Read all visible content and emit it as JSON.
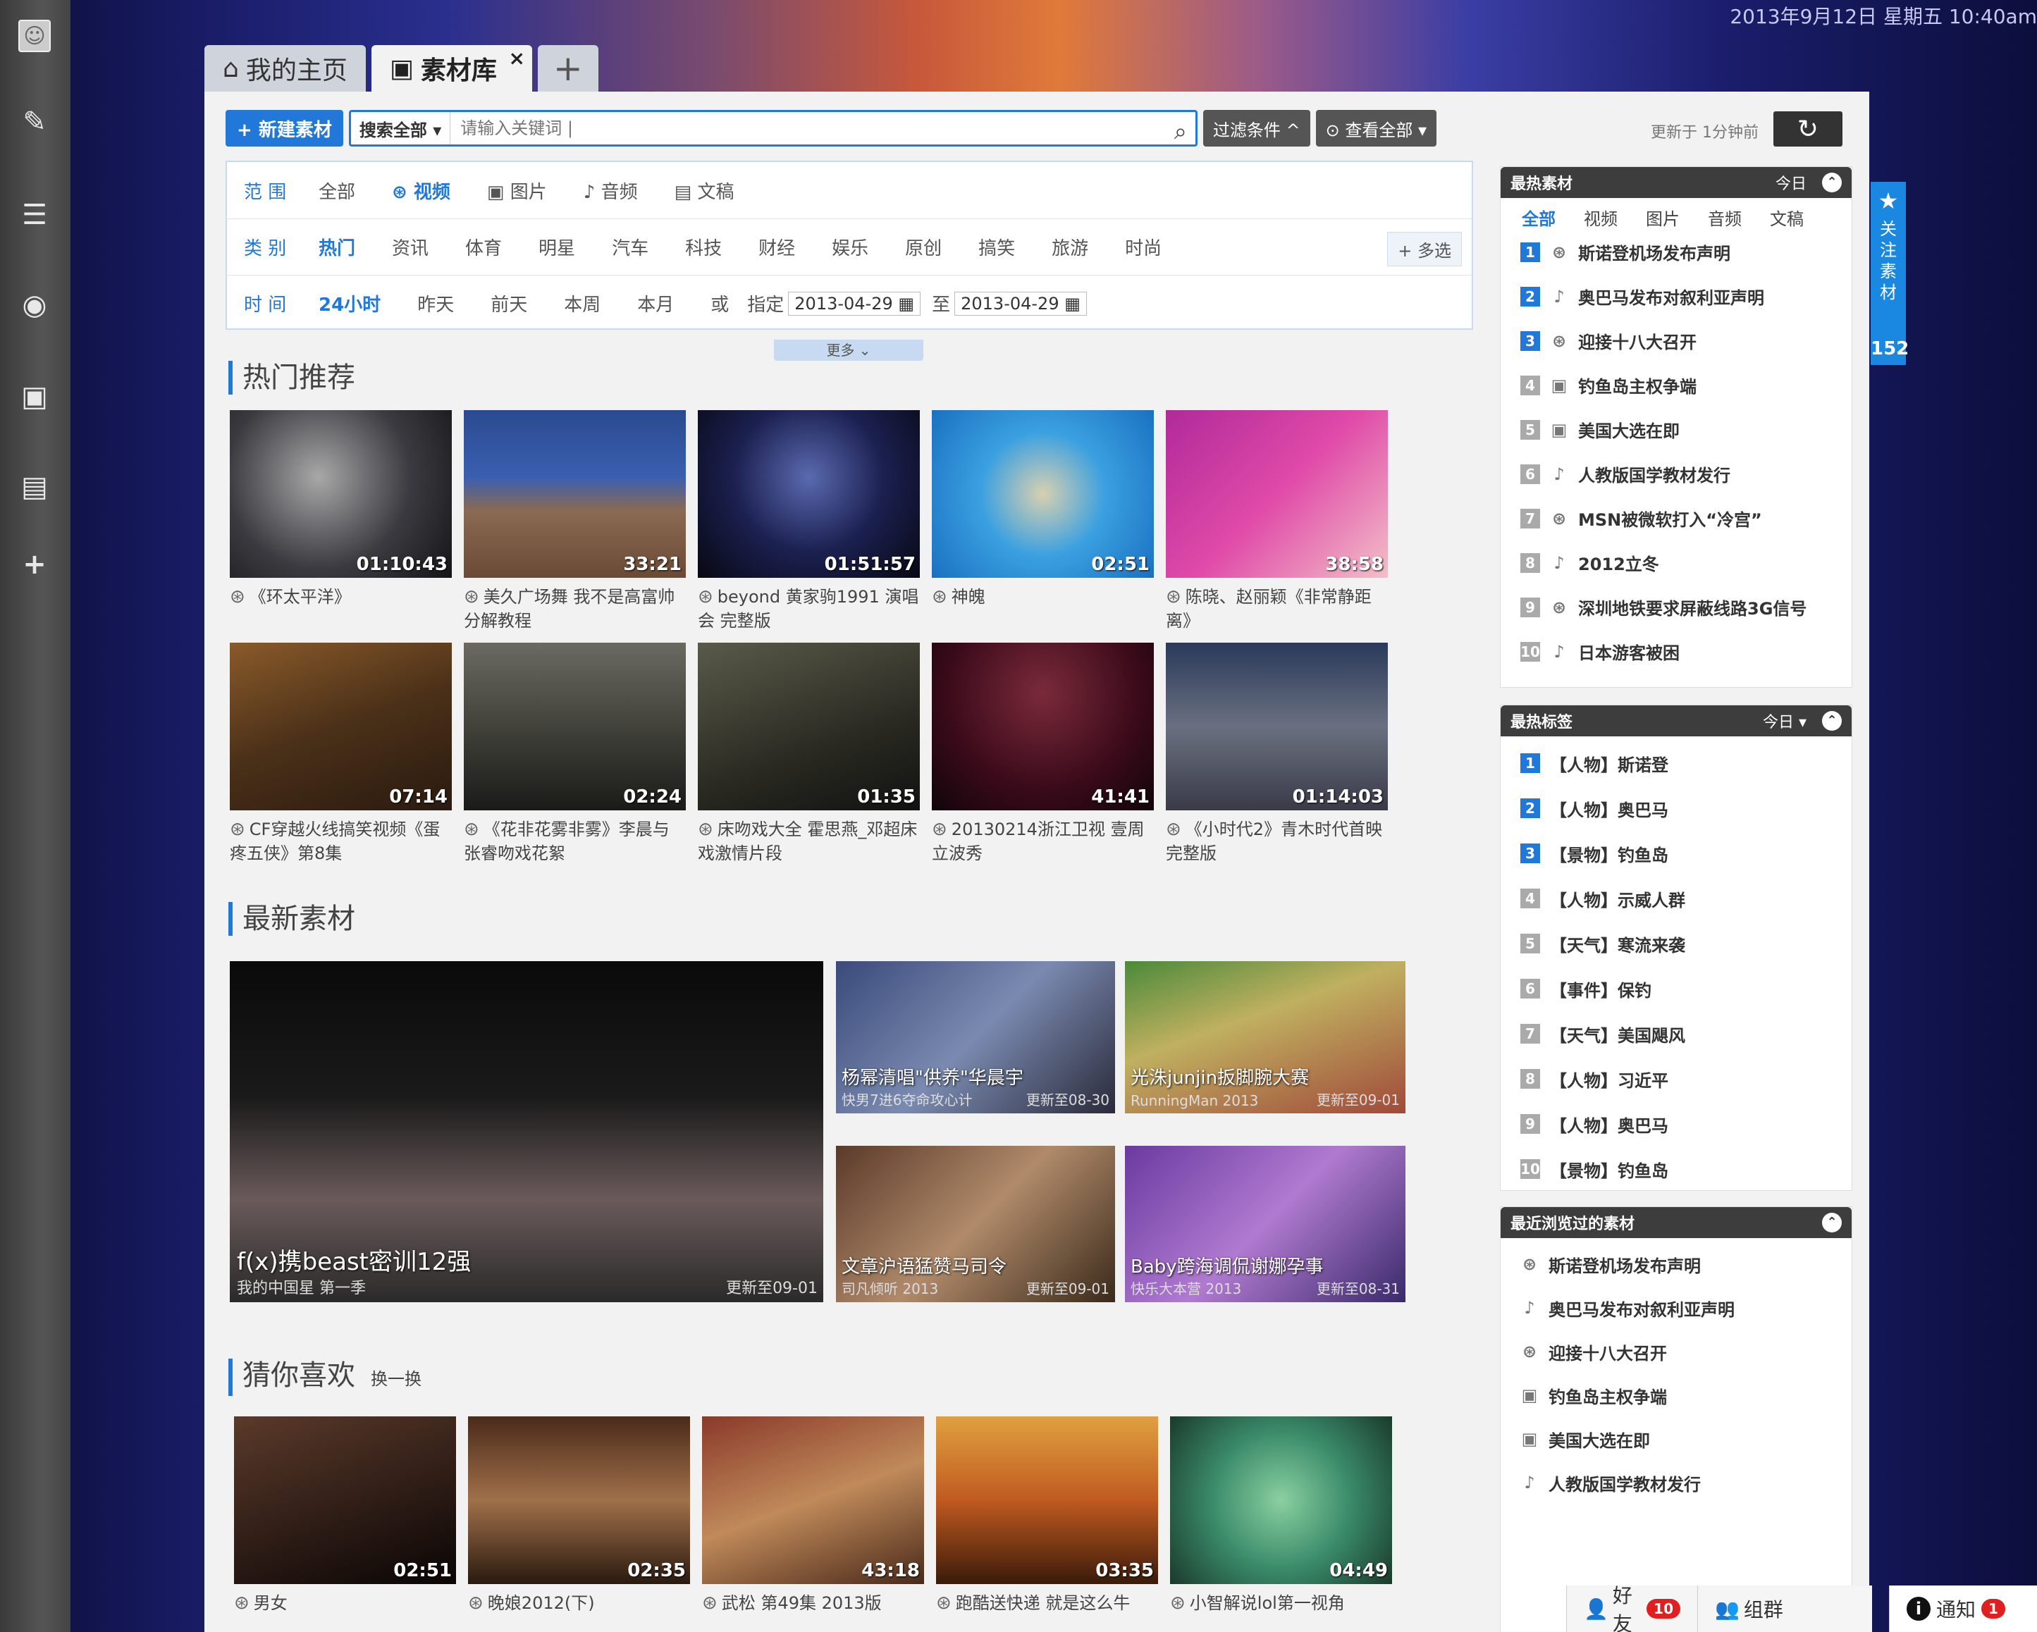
{
  "datetime": "2013年9月12日 星期五 10:40am",
  "leftbar": {
    "icons": [
      "avatar-icon",
      "edit-icon",
      "list-icon",
      "globe-icon",
      "image-icon",
      "device-icon",
      "plus-icon"
    ]
  },
  "tabs": {
    "home": "我的主页",
    "library": "素材库",
    "add": "+",
    "close": "×"
  },
  "toolbar": {
    "new_label": "+ 新建素材",
    "scope": "搜索全部 ▾",
    "placeholder": "请输入关键词 |",
    "filter": "过滤条件 ^",
    "view": "⊙ 查看全部 ▾",
    "updated": "更新于 1分钟前",
    "refresh": "↻"
  },
  "filter": {
    "range_label": "范 围",
    "ranges": [
      "全部",
      "视频",
      "图片",
      "音频",
      "文稿"
    ],
    "cat_label": "类 别",
    "cats": [
      "热门",
      "资讯",
      "体育",
      "明星",
      "汽车",
      "科技",
      "财经",
      "娱乐",
      "原创",
      "搞笑",
      "旅游",
      "时尚"
    ],
    "multi": "+ 多选",
    "time_label": "时 间",
    "times": [
      "24小时",
      "昨天",
      "前天",
      "本周",
      "本月"
    ],
    "or": "或",
    "specify": "指定",
    "date_from": "2013-04-29",
    "to": "至",
    "date_to": "2013-04-29",
    "more": "更多 ⌄"
  },
  "hot": {
    "title": "热门推荐",
    "items": [
      {
        "dur": "01:10:43",
        "cap": "《环太平洋》"
      },
      {
        "dur": "33:21",
        "cap": "美久广场舞 我不是高富帅分解教程"
      },
      {
        "dur": "01:51:57",
        "cap": "beyond 黄家驹1991 演唱会 完整版"
      },
      {
        "dur": "02:51",
        "cap": "神魄"
      },
      {
        "dur": "38:58",
        "cap": "陈晓、赵丽颖《非常静距离》"
      },
      {
        "dur": "07:14",
        "cap": "CF穿越火线搞笑视频《蛋疼五侠》第8集"
      },
      {
        "dur": "02:24",
        "cap": "《花非花雾非雾》李晨与张睿吻戏花絮"
      },
      {
        "dur": "01:35",
        "cap": "床吻戏大全 霍思燕_邓超床戏激情片段"
      },
      {
        "dur": "41:41",
        "cap": "20130214浙江卫视 壹周立波秀"
      },
      {
        "dur": "01:14:03",
        "cap": "《小时代2》青木时代首映完整版"
      }
    ]
  },
  "latest": {
    "title": "最新素材",
    "items": [
      {
        "t1": "f(x)携beast密训12强",
        "t2": "我的中国星 第一季",
        "t3": "更新至09-01"
      },
      {
        "t1": "杨幂清唱\"供养\"华晨宇",
        "t2": "快男7进6夺命攻心计",
        "t3": "更新至08-30"
      },
      {
        "t1": "光洙junjin扳脚腕大赛",
        "t2": "RunningMan 2013",
        "t3": "更新至09-01"
      },
      {
        "t1": "文章沪语猛赞马司令",
        "t2": "司凡倾听 2013",
        "t3": "更新至09-01"
      },
      {
        "t1": "Baby跨海调侃谢娜孕事",
        "t2": "快乐大本营 2013",
        "t3": "更新至08-31"
      }
    ]
  },
  "guess": {
    "title": "猜你喜欢",
    "swap": "换一换",
    "items": [
      {
        "dur": "02:51",
        "cap": "男女"
      },
      {
        "dur": "02:35",
        "cap": "晚娘2012(下)"
      },
      {
        "dur": "43:18",
        "cap": "武松 第49集 2013版"
      },
      {
        "dur": "03:35",
        "cap": "跑酷送快递 就是这么牛"
      },
      {
        "dur": "04:49",
        "cap": "小智解说lol第一视角"
      }
    ]
  },
  "hotmat": {
    "title": "最热素材",
    "range": "今日",
    "tabs": [
      "全部",
      "视频",
      "图片",
      "音频",
      "文稿"
    ],
    "items": [
      {
        "n": "1",
        "icon": "video",
        "t": "斯诺登机场发布声明"
      },
      {
        "n": "2",
        "icon": "audio",
        "t": "奥巴马发布对叙利亚声明"
      },
      {
        "n": "3",
        "icon": "video",
        "t": "迎接十八大召开"
      },
      {
        "n": "4",
        "icon": "image",
        "t": "钓鱼岛主权争端"
      },
      {
        "n": "5",
        "icon": "image",
        "t": "美国大选在即"
      },
      {
        "n": "6",
        "icon": "audio",
        "t": "人教版国学教材发行"
      },
      {
        "n": "7",
        "icon": "video",
        "t": "MSN被微软打入“冷宫”"
      },
      {
        "n": "8",
        "icon": "audio",
        "t": "2012立冬"
      },
      {
        "n": "9",
        "icon": "video",
        "t": "深圳地铁要求屏蔽线路3G信号"
      },
      {
        "n": "10",
        "icon": "audio",
        "t": "日本游客被困"
      }
    ]
  },
  "hottags": {
    "title": "最热标签",
    "range": "今日 ▾",
    "items": [
      {
        "n": "1",
        "t": "【人物】斯诺登"
      },
      {
        "n": "2",
        "t": "【人物】奥巴马"
      },
      {
        "n": "3",
        "t": "【景物】钓鱼岛"
      },
      {
        "n": "4",
        "t": "【人物】示威人群"
      },
      {
        "n": "5",
        "t": "【天气】寒流来袭"
      },
      {
        "n": "6",
        "t": "【事件】保钓"
      },
      {
        "n": "7",
        "t": "【天气】美国飓风"
      },
      {
        "n": "8",
        "t": "【人物】习近平"
      },
      {
        "n": "9",
        "t": "【人物】奥巴马"
      },
      {
        "n": "10",
        "t": "【景物】钓鱼岛"
      }
    ]
  },
  "recent": {
    "title": "最近浏览过的素材",
    "items": [
      {
        "icon": "video",
        "t": "斯诺登机场发布声明"
      },
      {
        "icon": "audio",
        "t": "奥巴马发布对叙利亚声明"
      },
      {
        "icon": "video",
        "t": "迎接十八大召开"
      },
      {
        "icon": "image",
        "t": "钓鱼岛主权争端"
      },
      {
        "icon": "image",
        "t": "美国大选在即"
      },
      {
        "icon": "audio",
        "t": "人教版国学教材发行"
      }
    ]
  },
  "follow": {
    "label": "关注素材",
    "count": "152"
  },
  "bottom": {
    "friends": "好友",
    "friends_count": "10",
    "groups": "组群",
    "notify": "通知",
    "notify_count": "1"
  },
  "colors": {
    "accent": "#2178d8",
    "dark": "#3d3d3d",
    "badge": "#e02020"
  }
}
